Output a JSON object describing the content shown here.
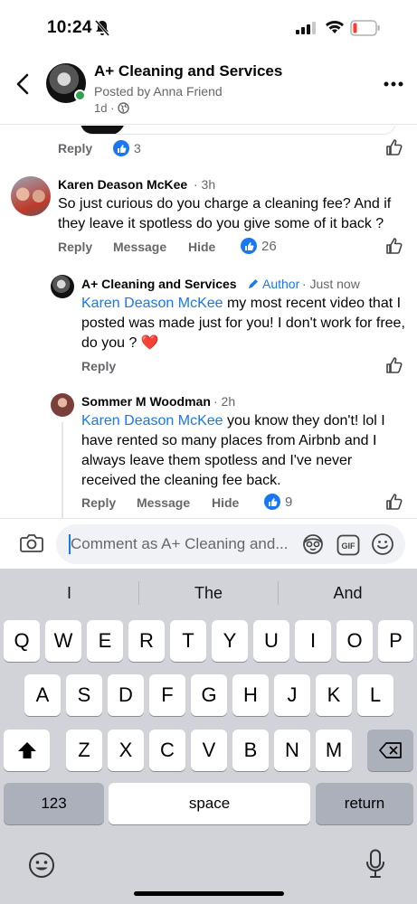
{
  "status_bar": {
    "time": "10:24"
  },
  "header": {
    "title": "A+ Cleaning and Services",
    "subtitle": "Posted by Anna Friend",
    "time": "1d ·"
  },
  "top_comment_actions": {
    "reply": "Reply",
    "likes": "3"
  },
  "comments": [
    {
      "author": "Karen Deason McKee",
      "time": "· 3h",
      "text": "So just curious do you charge a cleaning fee? And if they leave it spotless do you give some of it back ?",
      "reply": "Reply",
      "message": "Message",
      "hide": "Hide",
      "likes": "26"
    },
    {
      "author": "A+ Cleaning and Services",
      "badge": "Author",
      "time": "· Just now",
      "mention": "Karen Deason McKee",
      "text": " my most recent video that I posted was made just for you! I don't work for free, do you ? ❤️",
      "reply": "Reply"
    },
    {
      "author": "Sommer M Woodman",
      "time": "· 2h",
      "mention": "Karen Deason McKee",
      "text": " you know they don't! lol I have rented so many places from Airbnb and I always leave them spotless and I've never received the cleaning fee back.",
      "reply": "Reply",
      "message": "Message",
      "hide": "Hide",
      "likes": "9"
    }
  ],
  "composer": {
    "placeholder": "Comment as A+ Cleaning and..."
  },
  "keyboard": {
    "suggestions": [
      "I",
      "The",
      "And"
    ],
    "row1": [
      "Q",
      "W",
      "E",
      "R",
      "T",
      "Y",
      "U",
      "I",
      "O",
      "P"
    ],
    "row2": [
      "A",
      "S",
      "D",
      "F",
      "G",
      "H",
      "J",
      "K",
      "L"
    ],
    "row3": [
      "Z",
      "X",
      "C",
      "V",
      "B",
      "N",
      "M"
    ],
    "numbers_key": "123",
    "space_key": "space",
    "return_key": "return"
  },
  "colors": {
    "accent": "#1877f2",
    "muted": "#65676b",
    "keyboard_bg": "#d1d3d9"
  }
}
